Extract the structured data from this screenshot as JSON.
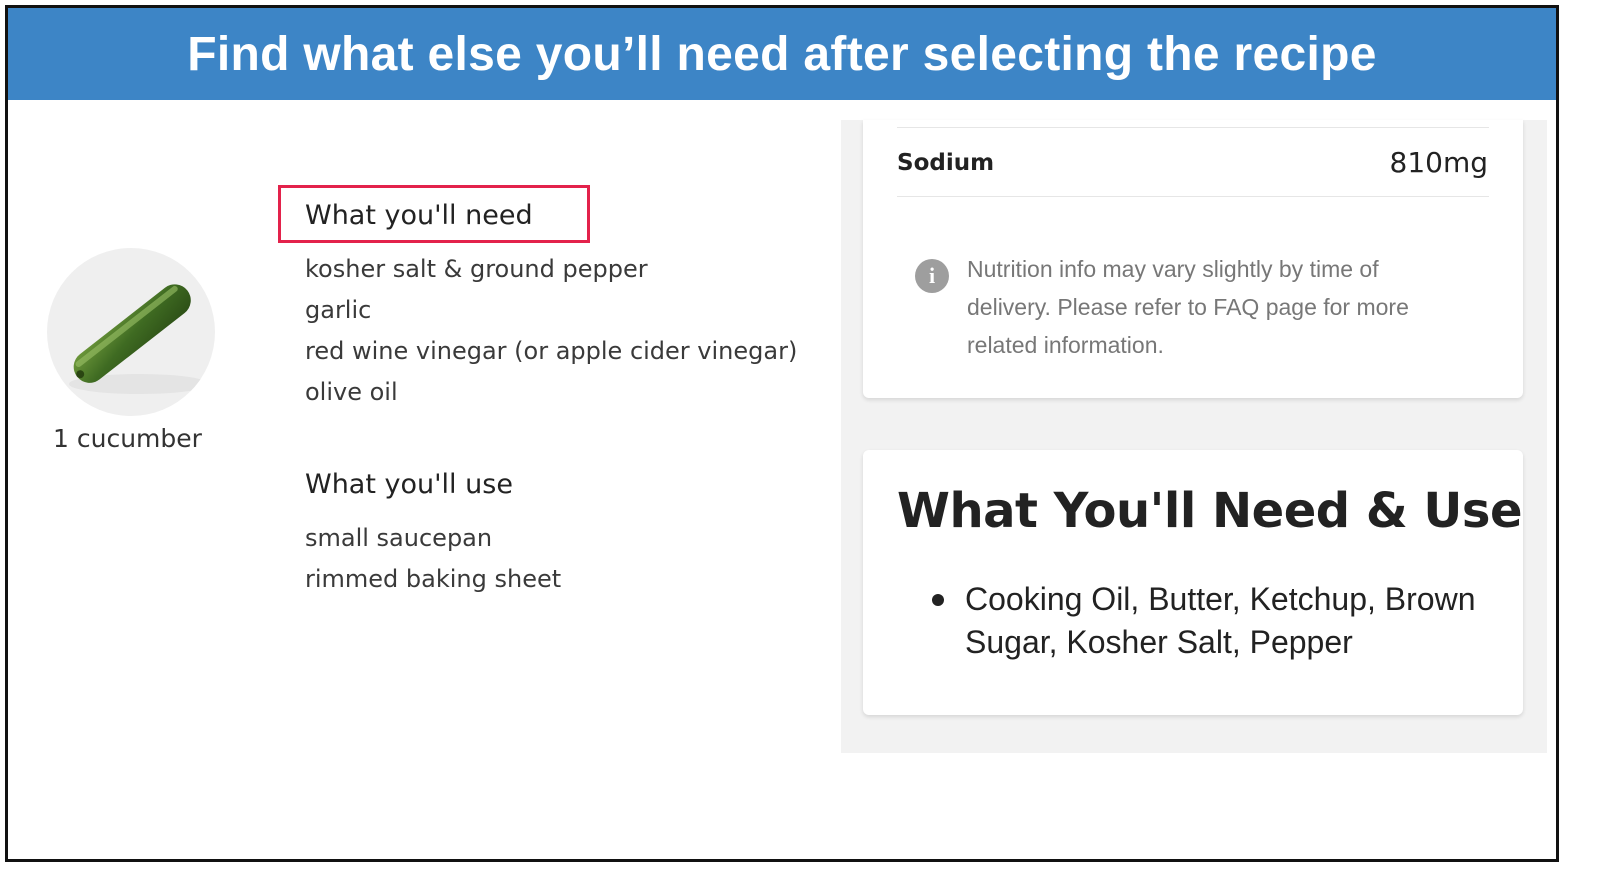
{
  "banner": {
    "title": "Find what else you’ll need after selecting the recipe"
  },
  "ingredient": {
    "caption": "1 cucumber",
    "icon": "cucumber-image"
  },
  "need_section": {
    "title": "What you'll need",
    "items": [
      "kosher salt & ground pepper",
      "garlic",
      "red wine vinegar (or apple cider vinegar)",
      "olive oil"
    ]
  },
  "use_section": {
    "title": "What you'll use",
    "items": [
      "small saucepan",
      "rimmed baking sheet"
    ]
  },
  "nutrition": {
    "sodium_label": "Sodium",
    "sodium_value": "810mg",
    "note": "Nutrition info may vary slightly by time of delivery. Please refer to FAQ page for more related information.",
    "note_icon": "info-icon"
  },
  "need_use_card": {
    "title": "What You'll Need & Use",
    "items": [
      "Cooking Oil, Butter, Ketchup, Brown Sugar, Kosher Salt, Pepper"
    ]
  },
  "colors": {
    "banner": "#3d85c6",
    "highlight": "#e3224b",
    "panel_bg": "#f2f2f2"
  }
}
